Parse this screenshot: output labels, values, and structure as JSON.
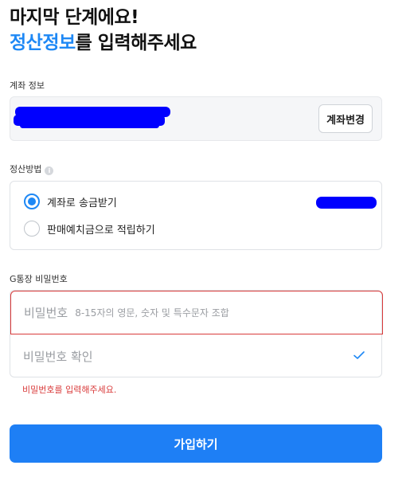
{
  "header": {
    "line1": "마지막 단계에요!",
    "line2_accent": "정산정보",
    "line2_rest": "를 입력해주세요"
  },
  "account": {
    "label": "계좌 정보",
    "change_button": "계좌변경"
  },
  "settlement": {
    "label": "정산방법",
    "info_icon": "i",
    "options": [
      {
        "label": "계좌로 송금받기",
        "checked": true
      },
      {
        "label": "판매예치금으로 적립하기",
        "checked": false
      }
    ]
  },
  "password": {
    "label": "G통장 비밀번호",
    "field_label": "비밀번호",
    "field_placeholder": "8-15자의 영문, 숫자 및 특수문자 조합",
    "confirm_label": "비밀번호 확인",
    "error": "비밀번호를 입력해주세요."
  },
  "submit_label": "가입하기",
  "colors": {
    "accent": "#1e88f5",
    "error": "#d93b3b",
    "redaction": "#0000ff"
  }
}
